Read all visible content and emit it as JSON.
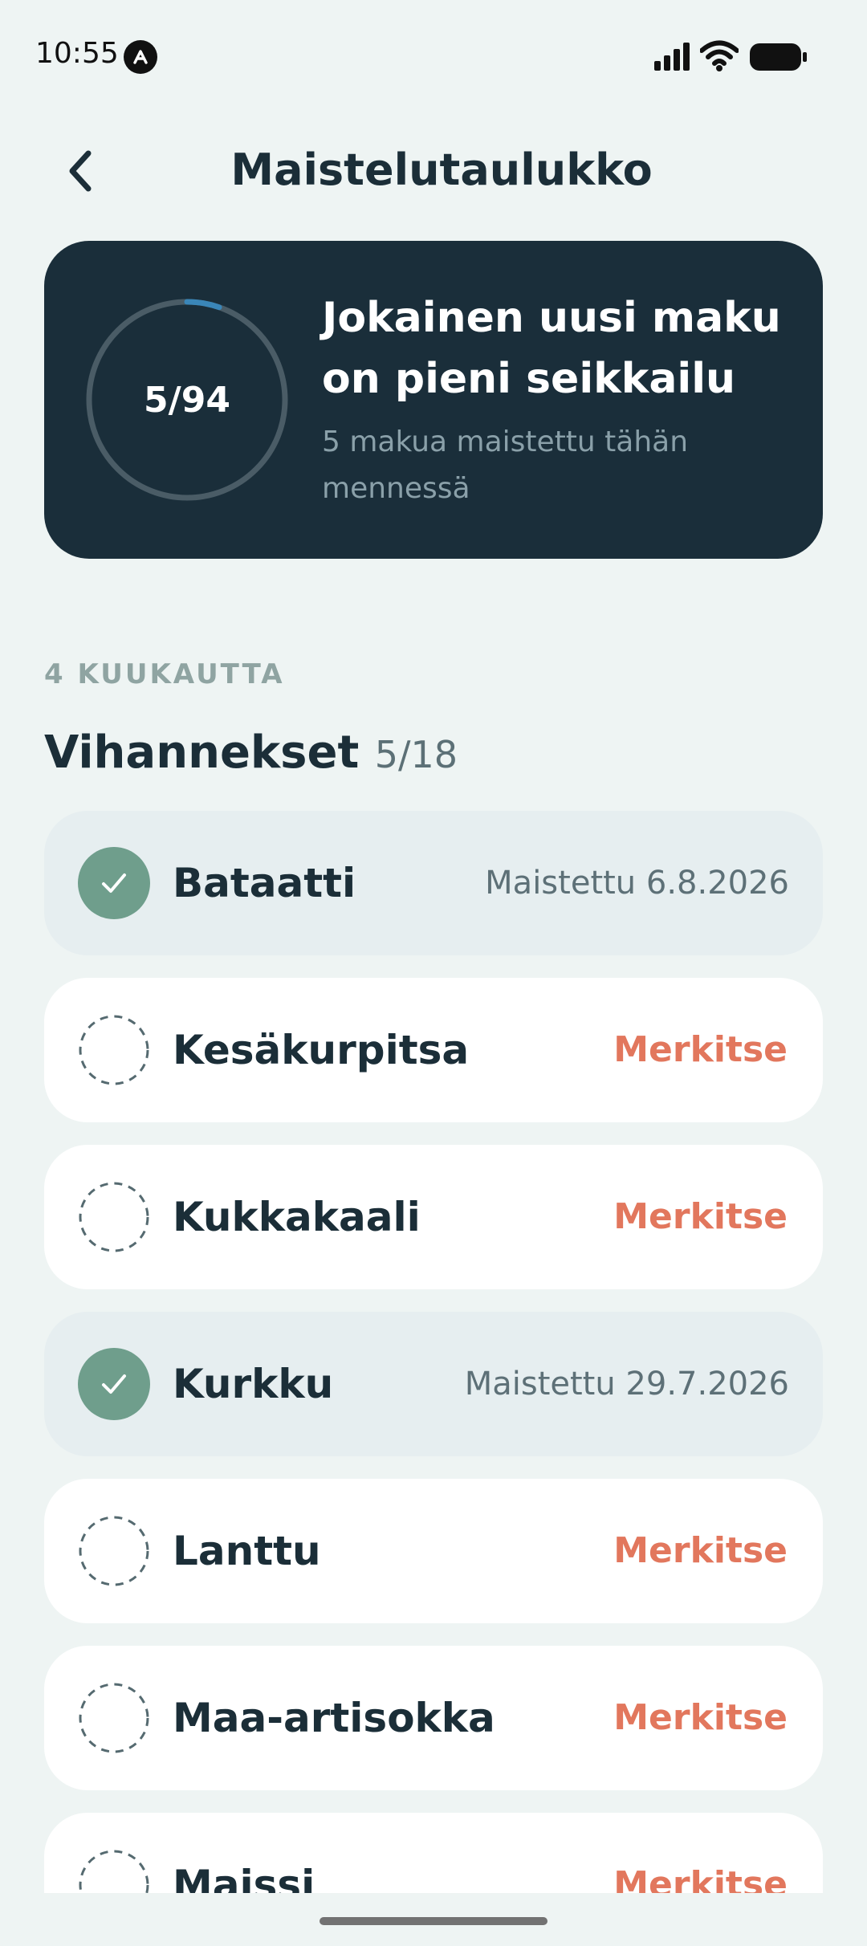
{
  "status_bar": {
    "time": "10:55"
  },
  "header": {
    "title": "Maistelutaulukko"
  },
  "hero": {
    "progress_text": "5/94",
    "progress_tasted": 5,
    "progress_total": 94,
    "heading_line1": "Jokainen uusi maku",
    "heading_line2": "on pieni seikkailu",
    "subtitle": "5 makua maistettu tähän mennessä"
  },
  "section": {
    "age_label": "4 KUUKAUTTA",
    "category_name": "Vihannekset",
    "category_count": "5/18"
  },
  "items": [
    {
      "name": "Bataatti",
      "tasted": true,
      "status": "Maistettu 6.8.2026"
    },
    {
      "name": "Kesäkurpitsa",
      "tasted": false,
      "status": "Merkitse"
    },
    {
      "name": "Kukkakaali",
      "tasted": false,
      "status": "Merkitse"
    },
    {
      "name": "Kurkku",
      "tasted": true,
      "status": "Maistettu 29.7.2026"
    },
    {
      "name": "Lanttu",
      "tasted": false,
      "status": "Merkitse"
    },
    {
      "name": "Maa-artisokka",
      "tasted": false,
      "status": "Merkitse"
    },
    {
      "name": "Maissi",
      "tasted": false,
      "status": "Merkitse"
    }
  ],
  "colors": {
    "background": "#eef4f3",
    "hero_background": "#1a2e3a",
    "accent_action": "#e2775d",
    "check_green": "#6f9e8c",
    "progress_track": "#4a5c66",
    "progress_fill": "#3a86b8"
  },
  "icons": {
    "back": "chevron-left-icon",
    "tasted": "check-circle-icon",
    "untasted": "dashed-circle-icon"
  }
}
